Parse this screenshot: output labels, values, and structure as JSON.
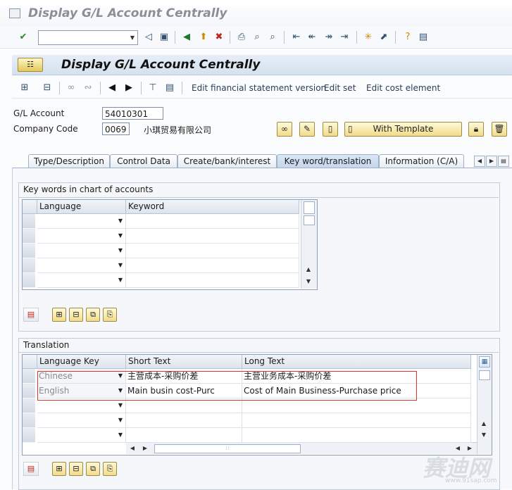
{
  "window": {
    "title": "Display G/L Account Centrally"
  },
  "standard_toolbar": {
    "command_field_value": "",
    "icons": [
      "enter-icon",
      "save-icon",
      "back-icon",
      "exit-icon",
      "cancel-icon",
      "print-icon",
      "find-icon",
      "find-next-icon",
      "first-page-icon",
      "previous-page-icon",
      "next-page-icon",
      "last-page-icon",
      "create-session-icon",
      "shortcut-icon",
      "help-icon",
      "layout-menu-icon"
    ]
  },
  "app": {
    "title": "Display G/L Account Centrally",
    "menu_label": "☷",
    "toolbar_links": [
      "Edit financial statement version",
      "Edit set",
      "Edit cost element"
    ]
  },
  "header": {
    "gl_account_label": "G/L Account",
    "gl_account_value": "54010301",
    "company_code_label": "Company Code",
    "company_code_value": "0069",
    "company_name": "小琪贸易有限公司",
    "with_template_label": "With Template"
  },
  "tabs": [
    {
      "label": "Type/Description"
    },
    {
      "label": "Control Data"
    },
    {
      "label": "Create/bank/interest"
    },
    {
      "label": "Key word/translation",
      "active": true
    },
    {
      "label": "Information (C/A)"
    }
  ],
  "keywords": {
    "title": "Key words in chart of accounts",
    "columns": [
      "Language",
      "Keyword"
    ],
    "rows": [
      {
        "language": "",
        "keyword": ""
      },
      {
        "language": "",
        "keyword": ""
      },
      {
        "language": "",
        "keyword": ""
      },
      {
        "language": "",
        "keyword": ""
      },
      {
        "language": "",
        "keyword": ""
      }
    ]
  },
  "translation": {
    "title": "Translation",
    "columns": [
      "Language Key",
      "Short Text",
      "Long Text"
    ],
    "rows": [
      {
        "language": "Chinese",
        "short": "主营成本-采购价差",
        "long": "主营业务成本-采购价差"
      },
      {
        "language": "English",
        "short": "Main busin cost-Purc",
        "long": "Cost of Main Business-Purchase price"
      },
      {
        "language": "",
        "short": "",
        "long": ""
      },
      {
        "language": "",
        "short": "",
        "long": ""
      },
      {
        "language": "",
        "short": "",
        "long": ""
      }
    ]
  },
  "watermark": {
    "text": "赛迪网",
    "url": "www.91sap.com"
  }
}
